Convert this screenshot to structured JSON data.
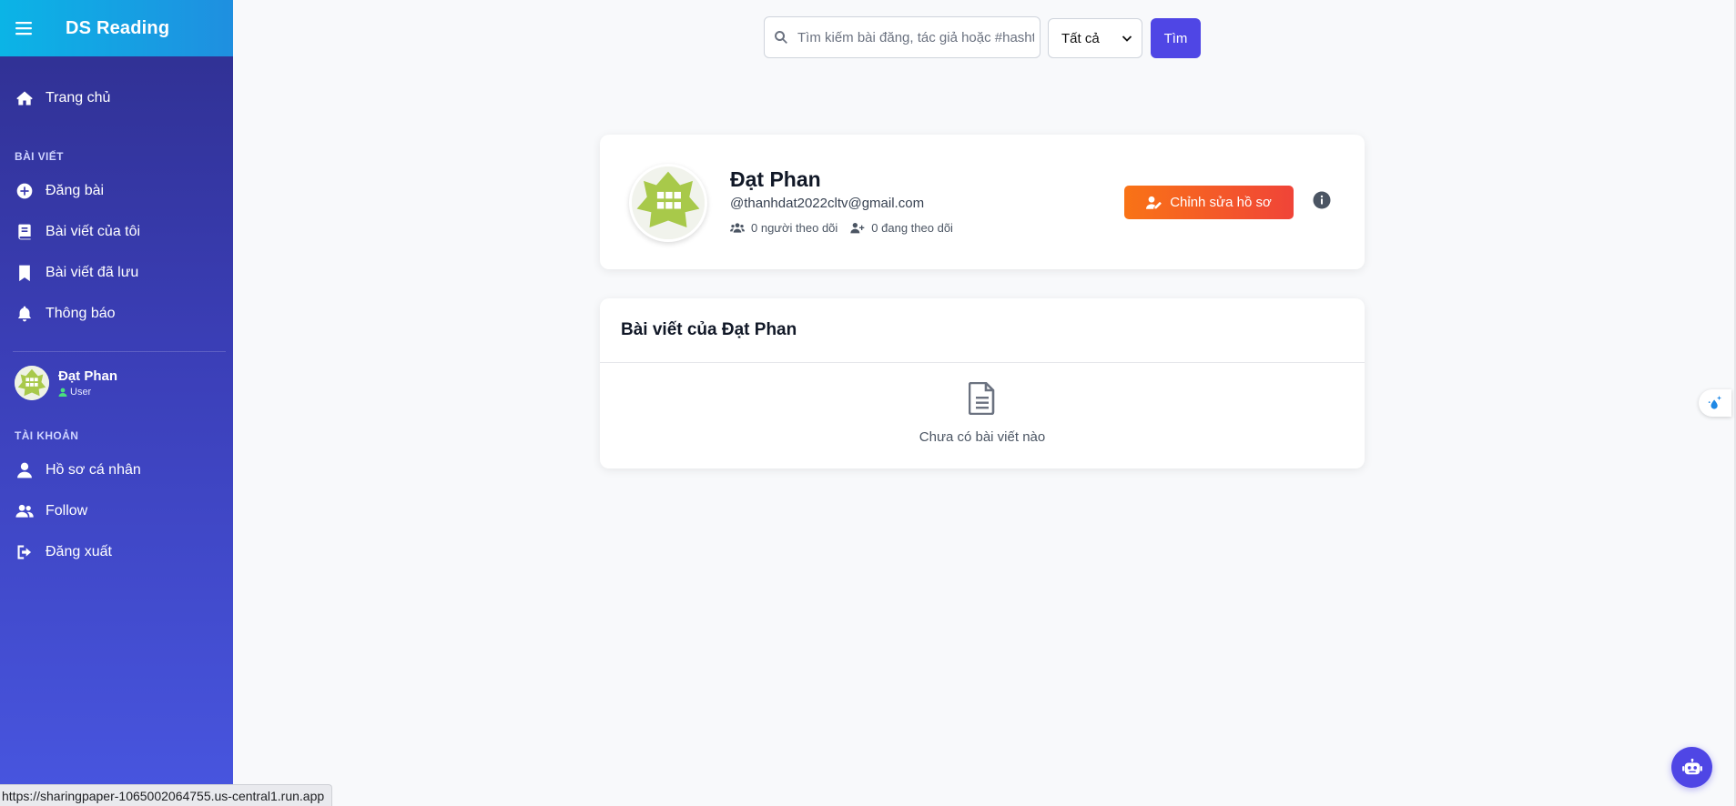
{
  "app": {
    "brand": "DS Reading"
  },
  "sidebar": {
    "home_label": "Trang chủ",
    "section_posts": "BÀI VIẾT",
    "items_posts": [
      {
        "label": "Đăng bài",
        "icon": "plus-circle-icon"
      },
      {
        "label": "Bài viết của tôi",
        "icon": "book-icon"
      },
      {
        "label": "Bài viết đã lưu",
        "icon": "bookmark-icon"
      },
      {
        "label": "Thông báo",
        "icon": "bell-icon"
      }
    ],
    "user": {
      "name": "Đạt Phan",
      "role": "User"
    },
    "section_account": "TÀI KHOẢN",
    "items_account": [
      {
        "label": "Hồ sơ cá nhân",
        "icon": "user-icon"
      },
      {
        "label": "Follow",
        "icon": "users-icon"
      },
      {
        "label": "Đăng xuất",
        "icon": "logout-icon"
      }
    ]
  },
  "search": {
    "placeholder": "Tìm kiếm bài đăng, tác giả hoặc #hashtag",
    "filter_value": "Tất cả",
    "button_label": "Tìm"
  },
  "profile": {
    "name": "Đạt Phan",
    "email": "@thanhdat2022cltv@gmail.com",
    "followers": "0 người theo dõi",
    "following": "0 đang theo dõi",
    "edit_label": "Chỉnh sửa hồ sơ"
  },
  "posts": {
    "title": "Bài viết của Đạt Phan",
    "empty_text": "Chưa có bài viết nào"
  },
  "status_bar": {
    "url": "https://sharingpaper-1065002064755.us-central1.run.app"
  },
  "colors": {
    "sidebar_top": "#2f2f8f",
    "sidebar_bottom": "#4856e0",
    "header_cyan": "#0bb4e6",
    "primary": "#4f46e5",
    "edit_orange": "#f97316",
    "edit_red": "#f04438",
    "avatar_green": "#a8c94a"
  }
}
